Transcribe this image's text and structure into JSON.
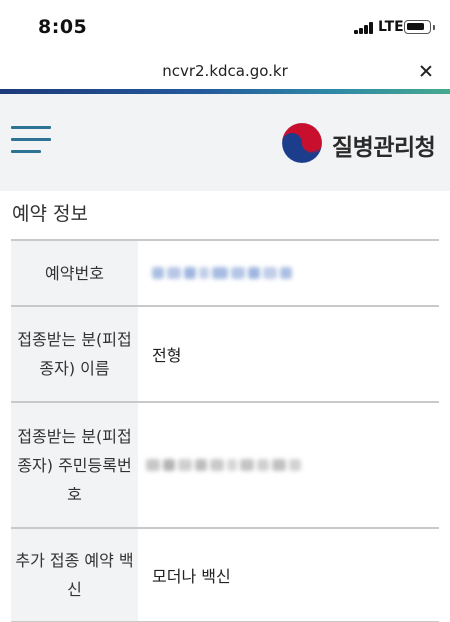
{
  "status_bar": {
    "time": "8:05",
    "network": "LTE"
  },
  "browser": {
    "url": "ncvr2.kdca.go.kr"
  },
  "header": {
    "logo_text": "질병관리청",
    "icons": {
      "menu": "hamburger-menu-icon",
      "close": "close-icon"
    }
  },
  "section": {
    "title": "예약 정보"
  },
  "table": {
    "rows": [
      {
        "label": "예약번호",
        "value": ""
      },
      {
        "label": "접종받는 분(피접종자) 이름",
        "value": "전형"
      },
      {
        "label": "접종받는 분(피접종자) 주민등록번호",
        "value": ""
      },
      {
        "label": "추가 접종 예약 백신",
        "value": "모더나 백신"
      }
    ]
  },
  "colors": {
    "accent_bar": [
      "#1d3a7a",
      "#47a98e"
    ],
    "header_bg": "#f2f3f5",
    "menu_icon": "#2f7394",
    "logo_red": "#c8102e",
    "logo_blue": "#1c3c8c"
  }
}
